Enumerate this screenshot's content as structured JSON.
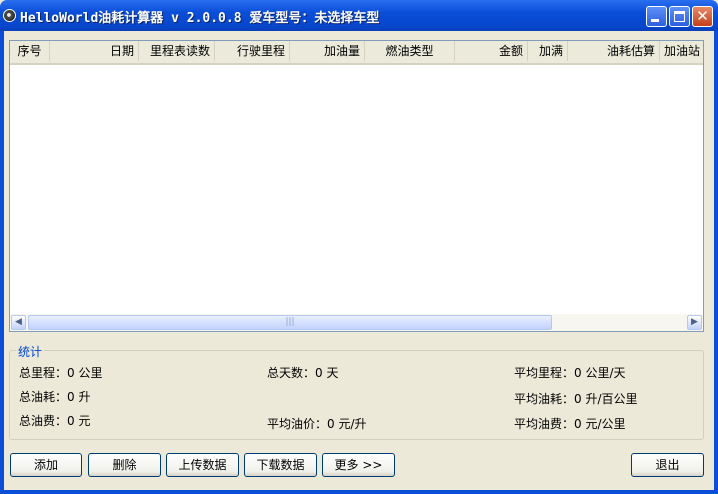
{
  "window": {
    "title": "HelloWorld油耗计算器 v 2.0.0.8  爱车型号：未选择车型",
    "min_icon": "minimize-icon",
    "max_icon": "maximize-icon",
    "close_icon": "close-icon",
    "close_glyph": "✕"
  },
  "table": {
    "columns": [
      {
        "label": "序号"
      },
      {
        "label": "日期"
      },
      {
        "label": "里程表读数"
      },
      {
        "label": "行驶里程"
      },
      {
        "label": "加油量"
      },
      {
        "label": "燃油类型"
      },
      {
        "label": "金额"
      },
      {
        "label": "加满"
      },
      {
        "label": "油耗估算"
      },
      {
        "label": "加油站"
      }
    ],
    "rows": [],
    "scroll": {
      "left_glyph": "◀",
      "right_glyph": "▶",
      "thumb_glyph": "|||"
    }
  },
  "stats": {
    "legend": "统计",
    "total_mileage": "总里程：0 公里",
    "total_days": "总天数：0 天",
    "avg_mileage": "平均里程：0 公里/天",
    "total_fuel": "总油耗：0 升",
    "avg_fuel": "平均油耗：0 升/百公里",
    "total_cost": "总油费：0 元",
    "avg_price": "平均油价：0 元/升",
    "avg_cost": "平均油费：0 元/公里"
  },
  "buttons": {
    "add": "添加",
    "delete": "删除",
    "upload": "上传数据",
    "download": "下载数据",
    "more": "更多 >>",
    "exit": "退出"
  }
}
